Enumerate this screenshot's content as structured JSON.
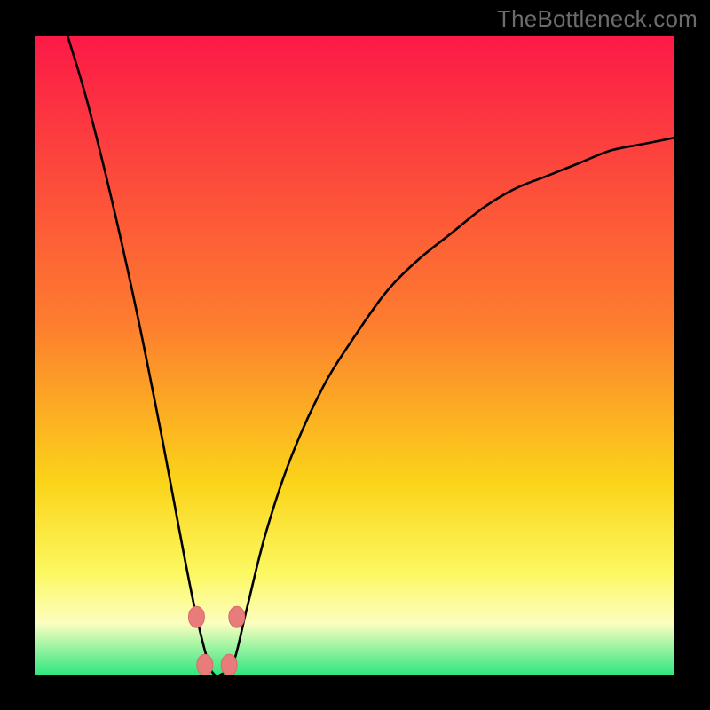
{
  "watermark": "TheBottleneck.com",
  "colors": {
    "frame": "#000000",
    "grad_top": "#fc1947",
    "grad_mid1": "#fd7d2f",
    "grad_mid2": "#fbd419",
    "grad_mid3": "#fcf860",
    "grad_mid4": "#fcfec0",
    "grad_bottom": "#2fe780",
    "curve": "#000000",
    "marker": "#e77c7a"
  },
  "chart_data": {
    "type": "line",
    "title": "",
    "xlabel": "",
    "ylabel": "",
    "xlim": [
      0,
      100
    ],
    "ylim": [
      0,
      100
    ],
    "comment": "Bottleneck percentage curve; minimum ≈0 near x≈28. Values estimated from pixel positions.",
    "series": [
      {
        "name": "bottleneck-curve",
        "x": [
          5,
          8,
          12,
          16,
          20,
          23,
          25,
          27,
          28,
          29,
          31,
          33,
          36,
          40,
          45,
          50,
          55,
          60,
          65,
          70,
          75,
          80,
          85,
          90,
          95,
          100
        ],
        "values": [
          100,
          90,
          74,
          56,
          36,
          20,
          10,
          2,
          0,
          0,
          2,
          10,
          22,
          34,
          45,
          53,
          60,
          65,
          69,
          73,
          76,
          78,
          80,
          82,
          83,
          84
        ]
      }
    ],
    "markers": {
      "name": "highlight-points",
      "points": [
        {
          "x": 25.2,
          "y": 9.0
        },
        {
          "x": 31.5,
          "y": 9.0
        },
        {
          "x": 26.5,
          "y": 1.5
        },
        {
          "x": 30.3,
          "y": 1.5
        }
      ]
    },
    "gradient_stops": [
      {
        "pct": 0,
        "meaning": "high-bottleneck",
        "color": "#fc1947"
      },
      {
        "pct": 45,
        "meaning": "",
        "color": "#fd7d2f"
      },
      {
        "pct": 70,
        "meaning": "",
        "color": "#fbd419"
      },
      {
        "pct": 84,
        "meaning": "",
        "color": "#fcf860"
      },
      {
        "pct": 92,
        "meaning": "",
        "color": "#fcfec0"
      },
      {
        "pct": 100,
        "meaning": "no-bottleneck",
        "color": "#2fe780"
      }
    ]
  }
}
